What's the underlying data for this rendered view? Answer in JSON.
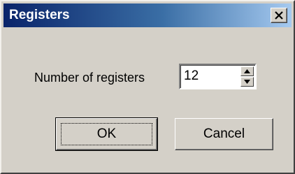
{
  "window": {
    "title": "Registers",
    "close_icon": "close-icon"
  },
  "form": {
    "registers_label": "Number of registers",
    "registers_value": "12",
    "spin_up_icon": "arrow-up-icon",
    "spin_down_icon": "arrow-down-icon"
  },
  "buttons": {
    "ok_label": "OK",
    "cancel_label": "Cancel"
  },
  "colors": {
    "titlebar_start": "#0a246a",
    "titlebar_end": "#a6caf0",
    "dialog_background": "#d4d0c8"
  }
}
